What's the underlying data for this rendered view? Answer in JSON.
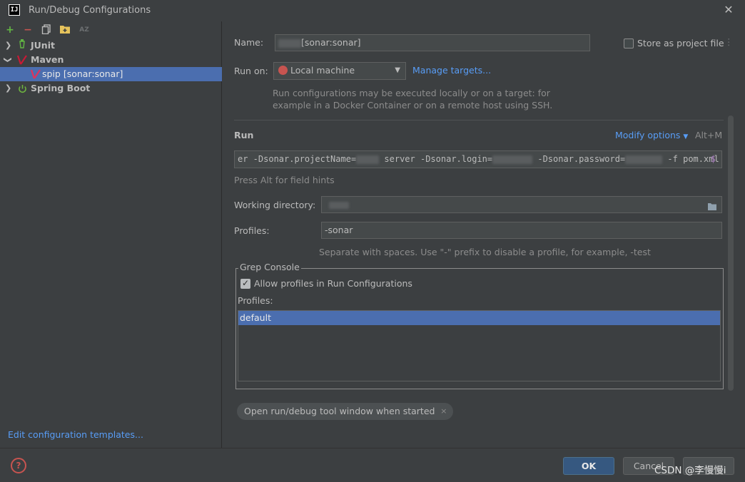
{
  "window": {
    "title": "Run/Debug Configurations",
    "logo_text": "IJ"
  },
  "toolbar": {
    "add_icon": "+",
    "remove_icon": "−",
    "copy_icon": "⧉",
    "folder_icon": "folder-plus",
    "sort_icon": "AZ"
  },
  "tree": {
    "items": [
      {
        "label": "JUnit",
        "icon": "junit-icon"
      },
      {
        "label": "Maven",
        "icon": "maven-icon"
      },
      {
        "label": "spip [sonar:sonar]",
        "icon": "maven-icon"
      },
      {
        "label": "Spring Boot",
        "icon": "spring-boot-icon"
      }
    ]
  },
  "edit_templates_link": "Edit configuration templates...",
  "form": {
    "name_label": "Name:",
    "name_value_suffix": "[sonar:sonar]",
    "store_as_project_file": "Store as project file",
    "run_on_label": "Run on:",
    "run_on_value": "Local machine",
    "manage_targets": "Manage targets...",
    "run_on_hint_line1": "Run configurations may be executed locally or on a target: for",
    "run_on_hint_line2": "example in a Docker Container or on a remote host using SSH.",
    "run_section": "Run",
    "modify_options": "Modify options",
    "modify_shortcut": "Alt+M",
    "command_parts": {
      "p1": "er -Dsonar.projectName=",
      "p2": "server -Dsonar.login=",
      "p3": "-Dsonar.password=",
      "p4": "-f pom.xml"
    },
    "command_macro_icon": "$",
    "field_hints": "Press Alt for field hints",
    "working_dir_label": "Working directory:",
    "profiles_label": "Profiles:",
    "profiles_value": "-sonar",
    "profiles_hint": "Separate with spaces. Use \"-\" prefix to disable a profile, for example, -test"
  },
  "grep_console": {
    "title": "Grep Console",
    "allow_profiles": "Allow profiles in Run Configurations",
    "profiles_label": "Profiles:",
    "profiles_list": [
      "default"
    ]
  },
  "chip": {
    "label": "Open run/debug tool window when started",
    "close": "×"
  },
  "buttons": {
    "ok": "OK",
    "cancel": "Cancel",
    "apply": ""
  },
  "watermark": "CSDN @李慢慢i",
  "colors": {
    "accent_link": "#589df6",
    "selection": "#4b6eaf",
    "ok_button": "#365880",
    "maven": "#c71a36",
    "junit": "#62b543",
    "spring": "#6db33f"
  }
}
